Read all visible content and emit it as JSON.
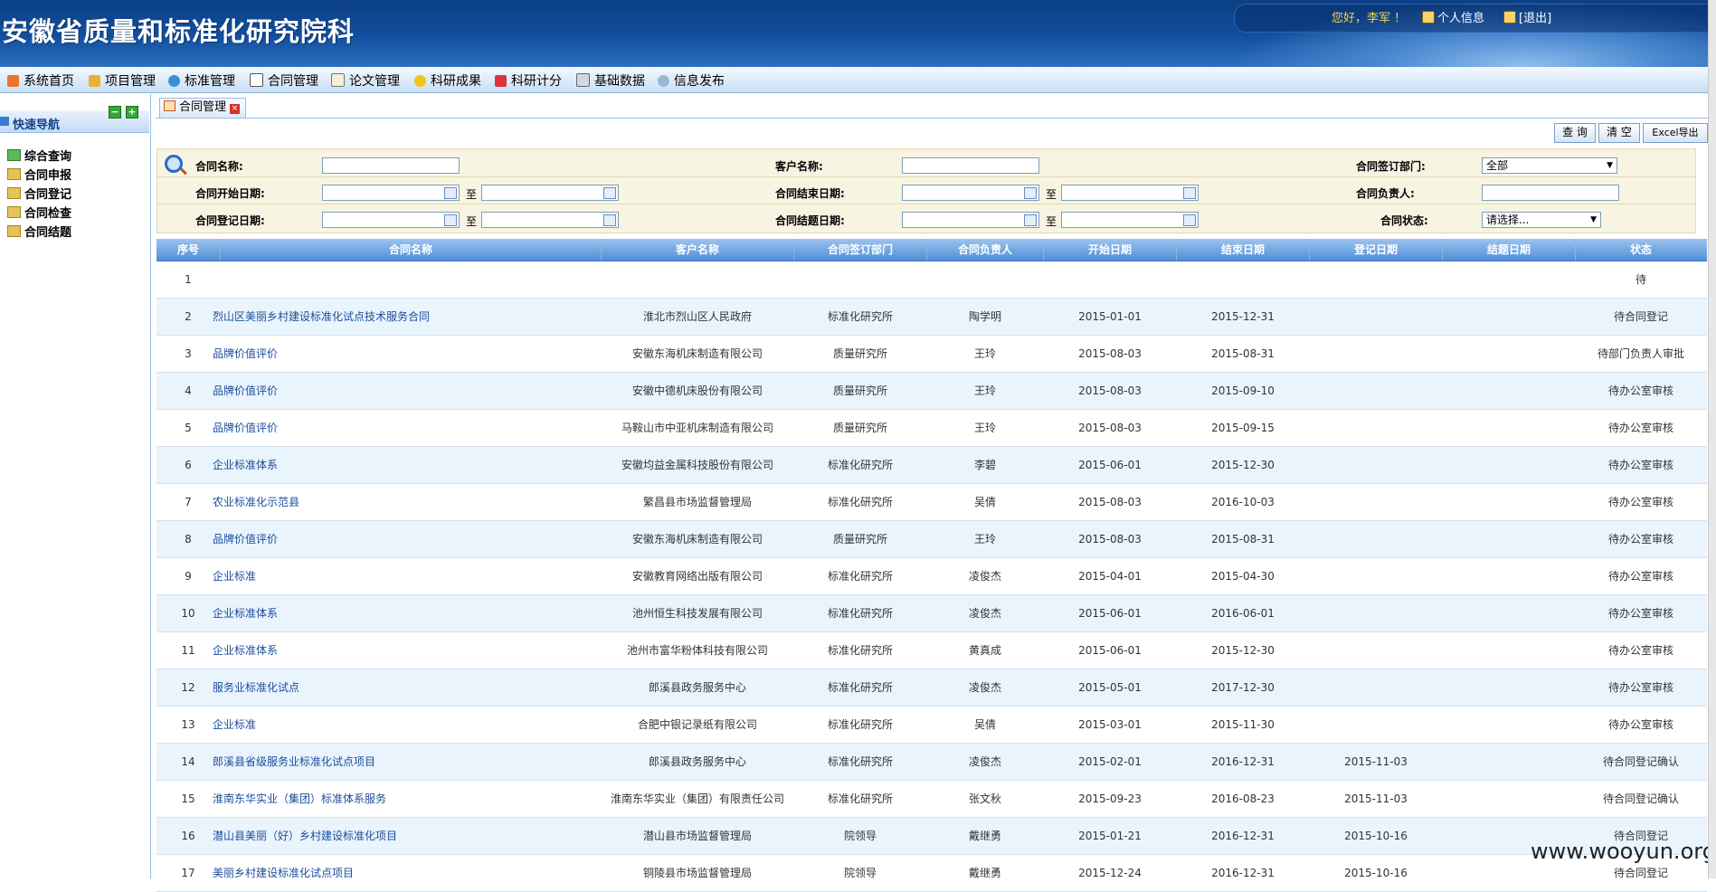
{
  "header": {
    "title": "安徽省质量和标准化研究院科",
    "greeting": "您好，李军 ！",
    "profile_label": "个人信息",
    "logout_label": "[退出]"
  },
  "menu": {
    "items": [
      "系统首页",
      "项目管理",
      "标准管理",
      "合同管理",
      "论文管理",
      "科研成果",
      "科研计分",
      "基础数据",
      "信息发布"
    ]
  },
  "sidebar": {
    "title": "快速导航",
    "expand_label": "+",
    "collapse_label": "−",
    "items": [
      "综合查询",
      "合同申报",
      "合同登记",
      "合同检查",
      "合同结题"
    ]
  },
  "tab": {
    "label": "合同管理",
    "close_label": "×"
  },
  "toolbar": {
    "query_label": "查 询",
    "clear_label": "清 空",
    "export_label": "Excel导出"
  },
  "search": {
    "contract_name_label": "合同名称:",
    "customer_name_label": "客户名称:",
    "dept_label": "合同签订部门:",
    "dept_value": "全部",
    "start_date_label": "合同开始日期:",
    "end_date_label": "合同结束日期:",
    "owner_label": "合同负责人:",
    "reg_date_label": "合同登记日期:",
    "close_date_label": "合同结题日期:",
    "status_label": "合同状态:",
    "status_value": "请选择...",
    "to_label": "至"
  },
  "table": {
    "columns": [
      "序号",
      "合同名称",
      "客户名称",
      "合同签订部门",
      "合同负责人",
      "开始日期",
      "结束日期",
      "登记日期",
      "结题日期",
      "状态"
    ],
    "rows": [
      {
        "no": "1",
        "name": "",
        "customer": "",
        "dept": "",
        "owner": "",
        "start": "",
        "end": "",
        "reg": "",
        "close": "",
        "status": "待"
      },
      {
        "no": "2",
        "name": "烈山区美丽乡村建设标准化试点技术服务合同",
        "customer": "淮北市烈山区人民政府",
        "dept": "标准化研究所",
        "owner": "陶学明",
        "start": "2015-01-01",
        "end": "2015-12-31",
        "reg": "",
        "close": "",
        "status": "待合同登记"
      },
      {
        "no": "3",
        "name": "品牌价值评价",
        "customer": "安徽东海机床制造有限公司",
        "dept": "质量研究所",
        "owner": "王玲",
        "start": "2015-08-03",
        "end": "2015-08-31",
        "reg": "",
        "close": "",
        "status": "待部门负责人审批"
      },
      {
        "no": "4",
        "name": "品牌价值评价",
        "customer": "安徽中德机床股份有限公司",
        "dept": "质量研究所",
        "owner": "王玲",
        "start": "2015-08-03",
        "end": "2015-09-10",
        "reg": "",
        "close": "",
        "status": "待办公室审核"
      },
      {
        "no": "5",
        "name": "品牌价值评价",
        "customer": "马鞍山市中亚机床制造有限公司",
        "dept": "质量研究所",
        "owner": "王玲",
        "start": "2015-08-03",
        "end": "2015-09-15",
        "reg": "",
        "close": "",
        "status": "待办公室审核"
      },
      {
        "no": "6",
        "name": "企业标准体系",
        "customer": "安徽均益金属科技股份有限公司",
        "dept": "标准化研究所",
        "owner": "李碧",
        "start": "2015-06-01",
        "end": "2015-12-30",
        "reg": "",
        "close": "",
        "status": "待办公室审核"
      },
      {
        "no": "7",
        "name": "农业标准化示范县",
        "customer": "繁昌县市场监督管理局",
        "dept": "标准化研究所",
        "owner": "吴倩",
        "start": "2015-08-03",
        "end": "2016-10-03",
        "reg": "",
        "close": "",
        "status": "待办公室审核"
      },
      {
        "no": "8",
        "name": "品牌价值评价",
        "customer": "安徽东海机床制造有限公司",
        "dept": "质量研究所",
        "owner": "王玲",
        "start": "2015-08-03",
        "end": "2015-08-31",
        "reg": "",
        "close": "",
        "status": "待办公室审核"
      },
      {
        "no": "9",
        "name": "企业标准",
        "customer": "安徽教育网络出版有限公司",
        "dept": "标准化研究所",
        "owner": "凌俊杰",
        "start": "2015-04-01",
        "end": "2015-04-30",
        "reg": "",
        "close": "",
        "status": "待办公室审核"
      },
      {
        "no": "10",
        "name": "企业标准体系",
        "customer": "池州恒生科技发展有限公司",
        "dept": "标准化研究所",
        "owner": "凌俊杰",
        "start": "2015-06-01",
        "end": "2016-06-01",
        "reg": "",
        "close": "",
        "status": "待办公室审核"
      },
      {
        "no": "11",
        "name": "企业标准体系",
        "customer": "池州市富华粉体科技有限公司",
        "dept": "标准化研究所",
        "owner": "黄真成",
        "start": "2015-06-01",
        "end": "2015-12-30",
        "reg": "",
        "close": "",
        "status": "待办公室审核"
      },
      {
        "no": "12",
        "name": "服务业标准化试点",
        "customer": "郎溪县政务服务中心",
        "dept": "标准化研究所",
        "owner": "凌俊杰",
        "start": "2015-05-01",
        "end": "2017-12-30",
        "reg": "",
        "close": "",
        "status": "待办公室审核"
      },
      {
        "no": "13",
        "name": "企业标准",
        "customer": "合肥中银记录纸有限公司",
        "dept": "标准化研究所",
        "owner": "吴倩",
        "start": "2015-03-01",
        "end": "2015-11-30",
        "reg": "",
        "close": "",
        "status": "待办公室审核"
      },
      {
        "no": "14",
        "name": "郎溪县省级服务业标准化试点项目",
        "customer": "郎溪县政务服务中心",
        "dept": "标准化研究所",
        "owner": "凌俊杰",
        "start": "2015-02-01",
        "end": "2016-12-31",
        "reg": "2015-11-03",
        "close": "",
        "status": "待合同登记确认"
      },
      {
        "no": "15",
        "name": "淮南东华实业（集团）标准体系服务",
        "customer": "淮南东华实业（集团）有限责任公司",
        "dept": "标准化研究所",
        "owner": "张文秋",
        "start": "2015-09-23",
        "end": "2016-08-23",
        "reg": "2015-11-03",
        "close": "",
        "status": "待合同登记确认"
      },
      {
        "no": "16",
        "name": "潜山县美丽（好）乡村建设标准化项目",
        "customer": "潜山县市场监督管理局",
        "dept": "院领导",
        "owner": "戴继勇",
        "start": "2015-01-21",
        "end": "2016-12-31",
        "reg": "2015-10-16",
        "close": "",
        "status": "待合同登记"
      },
      {
        "no": "17",
        "name": "美丽乡村建设标准化试点项目",
        "customer": "铜陵县市场监督管理局",
        "dept": "院领导",
        "owner": "戴继勇",
        "start": "2015-12-24",
        "end": "2016-12-31",
        "reg": "2015-10-16",
        "close": "",
        "status": "待合同登记"
      }
    ]
  },
  "watermark": "www.wooyun.org",
  "colors": {
    "header_bg": "#124f9e",
    "table_header": "#4f8fd8",
    "row_alt": "#eaf4fc",
    "link": "#1a4d9c",
    "greeting": "#f6d34a"
  }
}
